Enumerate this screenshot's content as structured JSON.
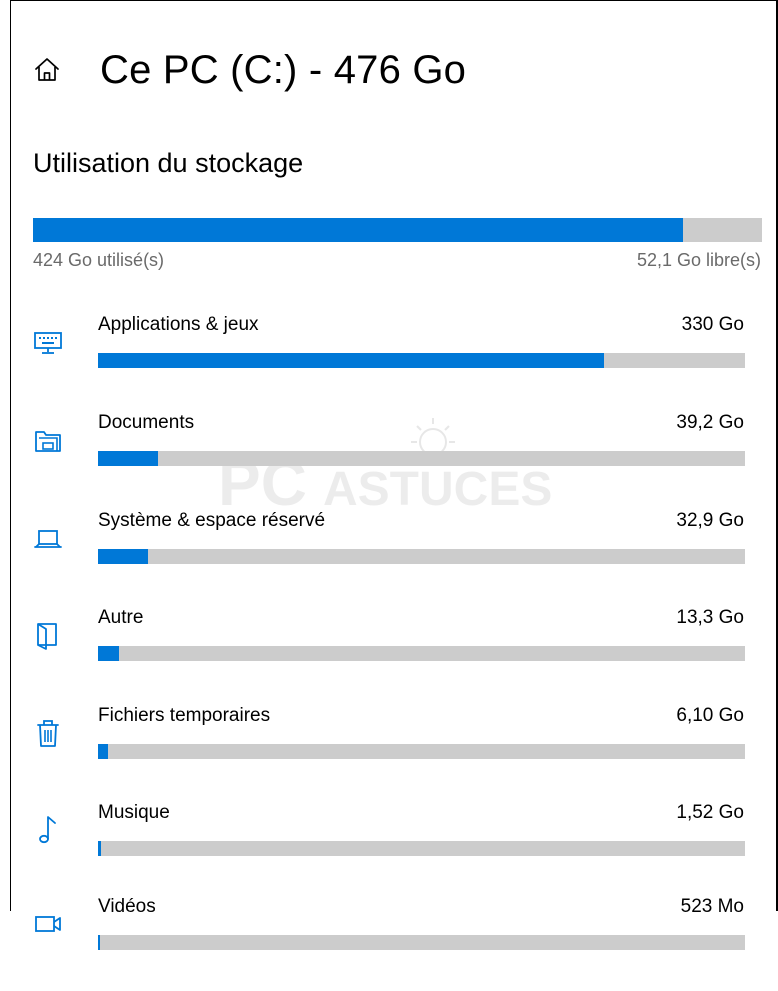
{
  "header": {
    "title": "Ce PC (C:) - 476 Go",
    "icon": "home-icon"
  },
  "storage": {
    "section_title": "Utilisation du stockage",
    "used_label": "424 Go utilisé(s)",
    "free_label": "52,1 Go libre(s)",
    "used_fraction": 0.891
  },
  "watermark": {
    "text_bold": "PC",
    "text_rest": "ASTUCES"
  },
  "categories": [
    {
      "label": "Applications & jeux",
      "size": "330 Go",
      "fraction": 0.782,
      "icon": "keyboard-monitor-icon"
    },
    {
      "label": "Documents",
      "size": "39,2 Go",
      "fraction": 0.093,
      "icon": "folder-icon"
    },
    {
      "label": "Système & espace réservé",
      "size": "32,9 Go",
      "fraction": 0.078,
      "icon": "laptop-icon"
    },
    {
      "label": "Autre",
      "size": "13,3 Go",
      "fraction": 0.032,
      "icon": "folder-open-icon"
    },
    {
      "label": "Fichiers temporaires",
      "size": "6,10 Go",
      "fraction": 0.015,
      "icon": "trash-icon"
    },
    {
      "label": "Musique",
      "size": "1,52 Go",
      "fraction": 0.004,
      "icon": "music-note-icon"
    },
    {
      "label": "Vidéos",
      "size": "523 Mo",
      "fraction": 0.001,
      "icon": "video-icon"
    }
  ],
  "colors": {
    "accent": "#0078d7",
    "track": "#cccccc",
    "secondary_text": "#6a6a6a"
  }
}
